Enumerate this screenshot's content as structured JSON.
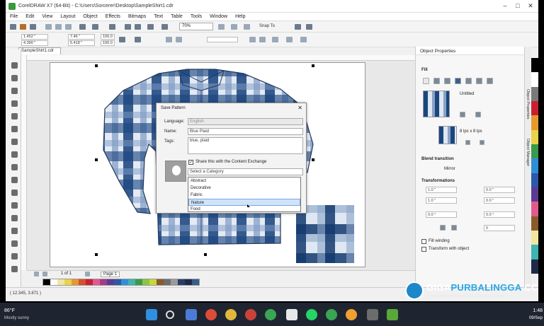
{
  "window": {
    "title": "CorelDRAW X7 (64-Bit) - C:\\Users\\Sorcerer\\Desktop\\SampleShirt1.cdr"
  },
  "menu": [
    "File",
    "Edit",
    "View",
    "Layout",
    "Object",
    "Effects",
    "Bitmaps",
    "Text",
    "Table",
    "Tools",
    "Window",
    "Help"
  ],
  "toolbar": {
    "zoom": "70%",
    "snap_to": "Snap To"
  },
  "propbar": {
    "x": "1.452 \"",
    "y": "4.390 \"",
    "w": "7.46 \"",
    "h": "5.418 \"",
    "sx": "100.0",
    "sy": "100.0",
    "pct": "%"
  },
  "doc_tab": "SampleShirt1.cdr",
  "dialog": {
    "title": "Save Pattern",
    "language_label": "Language:",
    "language_value": "English",
    "name_label": "Name:",
    "name_value": "Blue Plaid",
    "tags_label": "Tags:",
    "tags_value": "blue, plaid",
    "share_label": "Share this with the Content Exchange",
    "share_checked": "✓",
    "category_placeholder": "Select a Category",
    "category_options": [
      "Abstract",
      "Decorative",
      "Fabric",
      "Nature",
      "Food"
    ],
    "selected_index": 3
  },
  "pagenav": {
    "counter": "1 of 1",
    "page": "Page 1"
  },
  "status": {
    "coords": "( 12.345, 3.871 )"
  },
  "panel": {
    "title": "Object Properties",
    "fill": "Fill",
    "untitled": "Untitled",
    "size_label": "8 lps x 8 lps",
    "blend": "Blend transition",
    "mirror": "Mirror",
    "transformations": "Transformations",
    "tx": "1.0 \"",
    "ty": "1.0 \"",
    "skew": "0.0 °",
    "ra": "0.0 \"",
    "rb": "0.0 \"",
    "rc": "0.0 °",
    "rd": "0",
    "fill_winding": "Fill winding",
    "transform_with_object": "Transform with object"
  },
  "sidetabs": [
    "Object Properties",
    "Object Manager"
  ],
  "watermark": {
    "brand_a": "GIGA",
    "brand_b": "PURBALINGGA",
    "brand_c": ".CC",
    "tagline": "Free Download Software & Games Full Version"
  },
  "taskbar": {
    "temp": "86°F",
    "weather": "Mostly sunny",
    "time": "1:48",
    "date": "09/Sep"
  },
  "palette_colors": [
    "#000000",
    "#ffffff",
    "#f2e5a0",
    "#ead24c",
    "#e59a2f",
    "#d94f2b",
    "#c8202f",
    "#e15a8e",
    "#a33a8c",
    "#5b3a92",
    "#2e57a8",
    "#2f8fd6",
    "#3fb4b0",
    "#3a9a4b",
    "#8cc540",
    "#c7d93a",
    "#8b5a2b",
    "#6d6d6d",
    "#9a9a9a",
    "#2a3c66",
    "#1e2a4a",
    "#3a5a8a"
  ],
  "rpalette_colors": [
    "#000000",
    "#ffffff",
    "#7a7a7a",
    "#c8202f",
    "#e59a2f",
    "#ead24c",
    "#3a9a4b",
    "#2f8fd6",
    "#2e57a8",
    "#5b3a92",
    "#e15a8e",
    "#8b5a2b",
    "#f2e5a0",
    "#3fb4b0",
    "#1e2a4a"
  ]
}
